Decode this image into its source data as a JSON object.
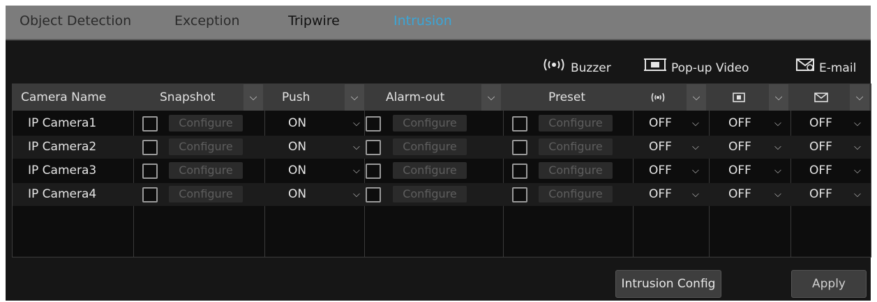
{
  "tabs": [
    {
      "label": "Object Detection"
    },
    {
      "label": "Exception"
    },
    {
      "label": "Tripwire"
    },
    {
      "label": "Intrusion",
      "active": true
    }
  ],
  "legend": {
    "buzzer": "Buzzer",
    "popup": "Pop-up Video",
    "email": "E-mail"
  },
  "columns": {
    "camera": "Camera Name",
    "snapshot": "Snapshot",
    "push": "Push",
    "alarm_out": "Alarm-out",
    "preset": "Preset"
  },
  "rows": [
    {
      "camera": "IP Camera1",
      "snapshot_cfg": "Configure",
      "push": "ON",
      "alarm_cfg": "Configure",
      "preset_cfg": "Configure",
      "buzzer": "OFF",
      "popup": "OFF",
      "email": "OFF"
    },
    {
      "camera": "IP Camera2",
      "snapshot_cfg": "Configure",
      "push": "ON",
      "alarm_cfg": "Configure",
      "preset_cfg": "Configure",
      "buzzer": "OFF",
      "popup": "OFF",
      "email": "OFF"
    },
    {
      "camera": "IP Camera3",
      "snapshot_cfg": "Configure",
      "push": "ON",
      "alarm_cfg": "Configure",
      "preset_cfg": "Configure",
      "buzzer": "OFF",
      "popup": "OFF",
      "email": "OFF"
    },
    {
      "camera": "IP Camera4",
      "snapshot_cfg": "Configure",
      "push": "ON",
      "alarm_cfg": "Configure",
      "preset_cfg": "Configure",
      "buzzer": "OFF",
      "popup": "OFF",
      "email": "OFF"
    }
  ],
  "buttons": {
    "intrusion_config": "Intrusion Config",
    "apply": "Apply"
  },
  "colors": {
    "active_tab": "#3aa6d8",
    "panel_bg": "#161616",
    "header_bg": "#3b3b3b"
  },
  "icons": {
    "buzzer": "buzzer-icon",
    "popup": "popup-video-icon",
    "email": "email-icon",
    "dropdown": "chevron-down-icon"
  }
}
